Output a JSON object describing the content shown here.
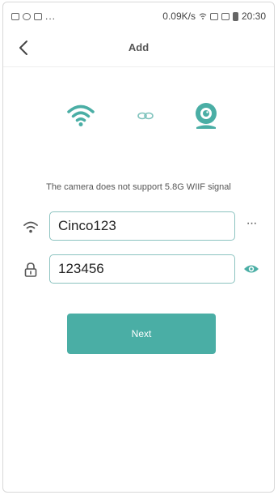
{
  "status_bar": {
    "left_dots": "...",
    "speed": "0.09K/s",
    "time": "20:30"
  },
  "header": {
    "title": "Add",
    "back_icon": "chevron-left-icon"
  },
  "illustration": {
    "wifi_icon": "wifi-icon",
    "link_icon": "link-icon",
    "camera_icon": "camera-icon"
  },
  "notice": "The camera does not support 5.8G WIIF signal",
  "form": {
    "ssid": {
      "icon": "wifi-icon",
      "value": "Cinco123",
      "more_icon": "more-icon",
      "more_label": "···"
    },
    "password": {
      "icon": "lock-icon",
      "value": "123456",
      "eye_icon": "eye-icon"
    }
  },
  "next_button": {
    "label": "Next"
  },
  "colors": {
    "accent": "#4aaea5",
    "input_border": "#8cc3c0"
  }
}
